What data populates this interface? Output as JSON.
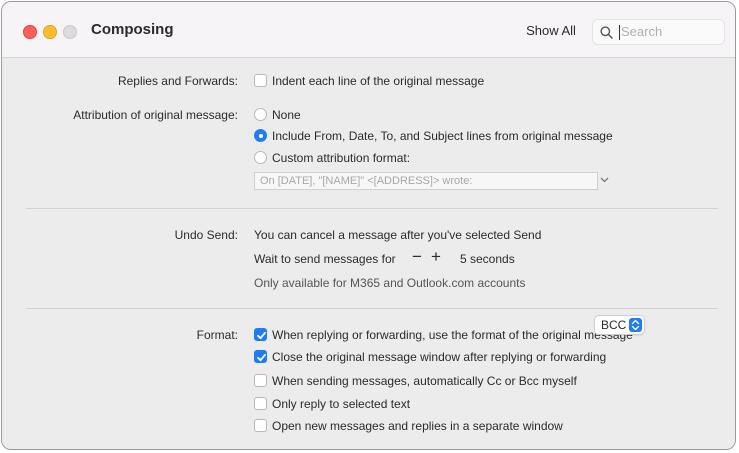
{
  "window": {
    "title": "Composing"
  },
  "toolbar": {
    "show_all": "Show All",
    "search_placeholder": "Search"
  },
  "replies": {
    "label": "Replies and Forwards:",
    "indent": {
      "label": "Indent each line of the original message",
      "checked": false
    }
  },
  "attribution": {
    "label": "Attribution of original message:",
    "options": [
      {
        "label": "None",
        "selected": false
      },
      {
        "label": "Include From, Date, To, and Subject lines from original message",
        "selected": true
      },
      {
        "label": "Custom attribution format:",
        "selected": false
      }
    ],
    "custom_format_placeholder": "On [DATE], \"[NAME]\" <[ADDRESS]> wrote:"
  },
  "undo_send": {
    "label": "Undo Send:",
    "description": "You can cancel a message after you've selected Send",
    "wait_label": "Wait to send messages for",
    "decrement": "−",
    "increment": "+",
    "wait_value": "5 seconds",
    "note": "Only available for M365 and Outlook.com accounts"
  },
  "format": {
    "label": "Format:",
    "options": [
      {
        "label": "When replying or forwarding, use the format of the original message",
        "checked": true
      },
      {
        "label": "Close the original message window after replying or forwarding",
        "checked": true
      },
      {
        "label": "When sending messages, automatically Cc or Bcc myself",
        "checked": false
      },
      {
        "label": "Only reply to selected text",
        "checked": false
      },
      {
        "label": "Open new messages and replies in a separate window",
        "checked": false
      }
    ],
    "cc_bcc_selected": "BCC"
  },
  "colors": {
    "accent": "#1f7cf5",
    "close": "#fe5f57",
    "minimize": "#febc2e"
  }
}
